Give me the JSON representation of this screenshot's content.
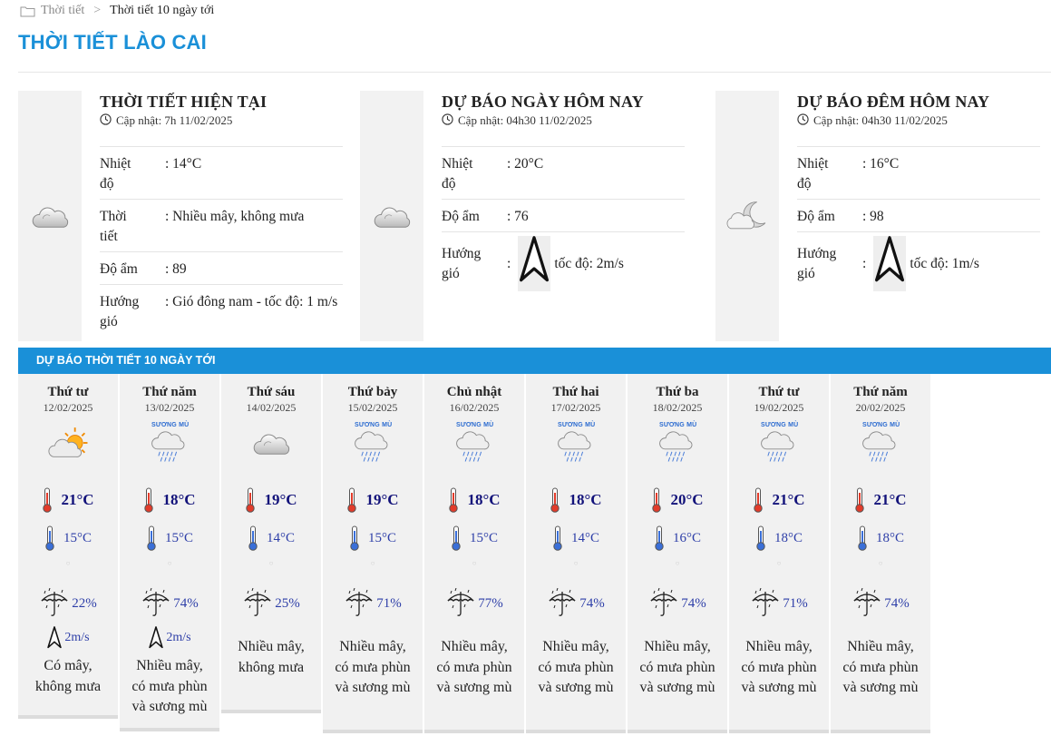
{
  "breadcrumb": {
    "home": "Thời tiết",
    "separator": ">",
    "current": "Thời tiết 10 ngày tới"
  },
  "page_title": "THỜI TIẾT LÀO CAI",
  "panels": [
    {
      "title": "THỜI TIẾT HIỆN TẠI",
      "update": "Cập nhật: 7h 11/02/2025",
      "icon": "cloudy-icon",
      "rows": [
        {
          "key": "Nhiệt độ",
          "value": ": 14°C"
        },
        {
          "key": "Thời tiết",
          "value": ": Nhiều mây, không mưa"
        },
        {
          "key": "Độ ẩm",
          "value": ": 89"
        },
        {
          "key": "Hướng gió",
          "value": ": Gió đông nam - tốc độ: 1 m/s"
        }
      ]
    },
    {
      "title": "DỰ BÁO NGÀY HÔM NAY",
      "update": "Cập nhật: 04h30 11/02/2025",
      "icon": "cloudy-icon",
      "rows": [
        {
          "key": "Nhiệt độ",
          "value": ": 20°C"
        },
        {
          "key": "Độ ẩm",
          "value": ": 76"
        },
        {
          "key": "Hướng gió",
          "colon": ":",
          "value": "tốc độ: 2m/s"
        }
      ]
    },
    {
      "title": "DỰ BÁO ĐÊM HÔM NAY",
      "update": "Cập nhật: 04h30 11/02/2025",
      "icon": "moon-cloud-icon",
      "rows": [
        {
          "key": "Nhiệt độ",
          "value": ": 16°C"
        },
        {
          "key": "Độ ẩm",
          "value": ": 98"
        },
        {
          "key": "Hướng gió",
          "colon": ":",
          "value": "tốc độ: 1m/s"
        }
      ]
    }
  ],
  "forecast": {
    "header": "DỰ BÁO THỜI TIẾT 10 NGÀY TỚI",
    "fog_label": "SƯƠNG MÙ",
    "dot": "○",
    "days": [
      {
        "name": "Thứ tư",
        "date": "12/02/2025",
        "icon": "sun-cloud-icon",
        "max": "21°C",
        "min": "15°C",
        "rain": "22%",
        "wind": "2m/s",
        "desc": [
          "Có mây,",
          "không mưa"
        ]
      },
      {
        "name": "Thứ năm",
        "date": "13/02/2025",
        "icon": "fog-rain-icon",
        "max": "18°C",
        "min": "15°C",
        "rain": "74%",
        "wind": "2m/s",
        "desc": [
          "Nhiều mây,",
          "có mưa phùn",
          "và sương mù"
        ]
      },
      {
        "name": "Thứ sáu",
        "date": "14/02/2025",
        "icon": "cloudy-icon",
        "max": "19°C",
        "min": "14°C",
        "rain": "25%",
        "wind": "",
        "desc": [
          "Nhiều mây,",
          "không mưa"
        ]
      },
      {
        "name": "Thứ bảy",
        "date": "15/02/2025",
        "icon": "fog-rain-icon",
        "max": "19°C",
        "min": "15°C",
        "rain": "71%",
        "wind": "",
        "desc": [
          "Nhiều mây,",
          "có mưa phùn",
          "và sương mù"
        ]
      },
      {
        "name": "Chủ nhật",
        "date": "16/02/2025",
        "icon": "fog-rain-icon",
        "max": "18°C",
        "min": "15°C",
        "rain": "77%",
        "wind": "",
        "desc": [
          "Nhiều mây,",
          "có mưa phùn",
          "và sương mù"
        ]
      },
      {
        "name": "Thứ hai",
        "date": "17/02/2025",
        "icon": "fog-rain-icon",
        "max": "18°C",
        "min": "14°C",
        "rain": "74%",
        "wind": "",
        "desc": [
          "Nhiều mây,",
          "có mưa phùn",
          "và sương mù"
        ]
      },
      {
        "name": "Thứ ba",
        "date": "18/02/2025",
        "icon": "fog-rain-icon",
        "max": "20°C",
        "min": "16°C",
        "rain": "74%",
        "wind": "",
        "desc": [
          "Nhiều mây,",
          "có mưa phùn",
          "và sương mù"
        ]
      },
      {
        "name": "Thứ tư",
        "date": "19/02/2025",
        "icon": "fog-rain-icon",
        "max": "21°C",
        "min": "18°C",
        "rain": "71%",
        "wind": "",
        "desc": [
          "Nhiều mây,",
          "có mưa phùn",
          "và sương mù"
        ]
      },
      {
        "name": "Thứ năm",
        "date": "20/02/2025",
        "icon": "fog-rain-icon",
        "max": "21°C",
        "min": "18°C",
        "rain": "74%",
        "wind": "",
        "desc": [
          "Nhiều mây,",
          "có mưa phùn",
          "và sương mù"
        ]
      }
    ]
  }
}
